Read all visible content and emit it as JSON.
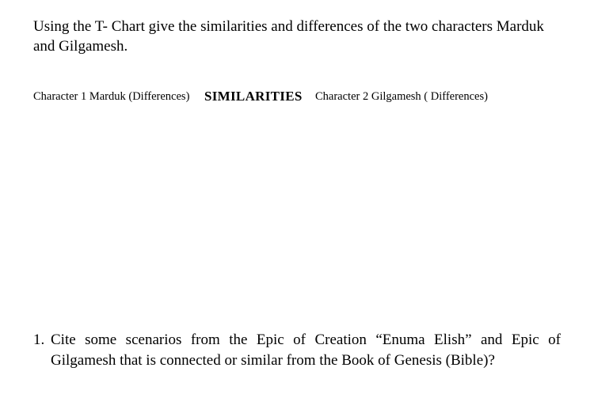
{
  "instructions": "Using the T- Chart give the similarities and differences of the two characters Marduk and Gilgamesh.",
  "tchart": {
    "col1": "Character 1  Marduk (Differences)",
    "col2": "SIMILARITIES",
    "col3": "Character 2  Gilgamesh  ( Differences)"
  },
  "question": {
    "number": "1.",
    "text": "Cite some scenarios from the Epic of Creation “Enuma Elish” and Epic of Gilgamesh that is connected or similar from the Book of Genesis (Bible)?"
  }
}
